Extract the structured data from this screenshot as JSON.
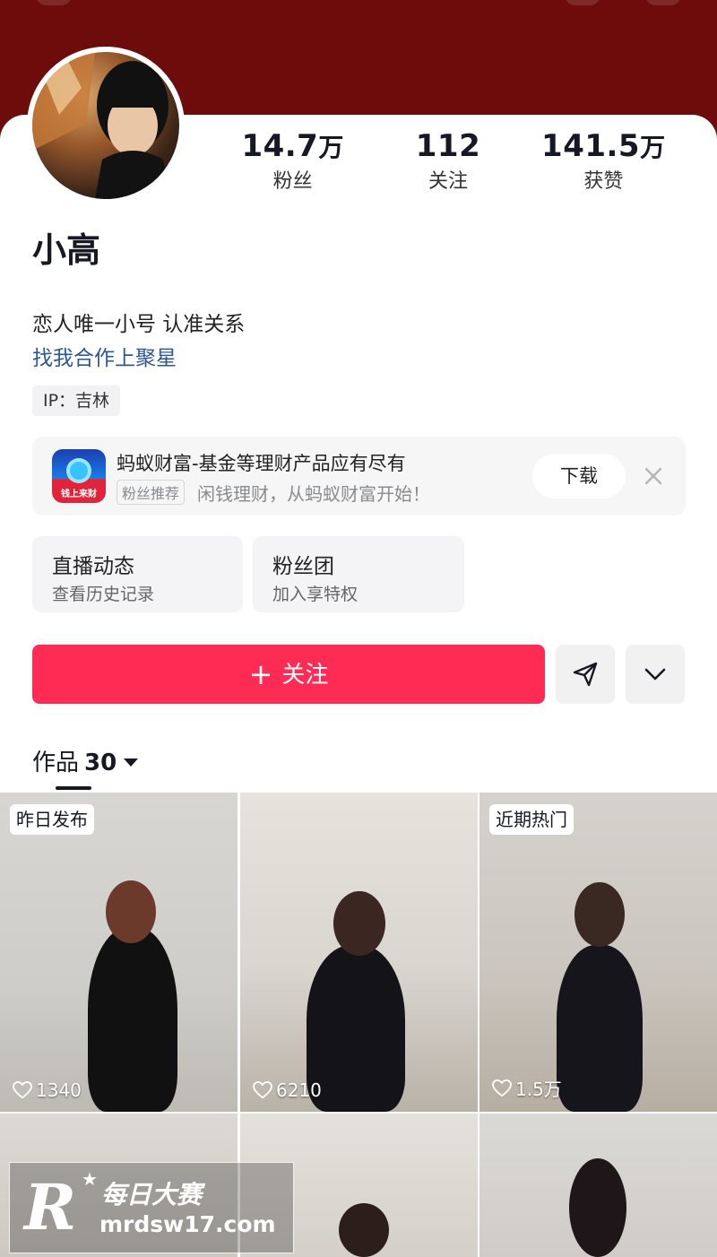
{
  "profile": {
    "name": "小高",
    "bio": "恋人唯一小号 认准关系",
    "bio_link": "找我合作上聚星",
    "ip_label": "IP：吉林"
  },
  "stats": [
    {
      "num": "14.7",
      "unit": "万",
      "label": "粉丝"
    },
    {
      "num": "112",
      "unit": "",
      "label": "关注"
    },
    {
      "num": "141.5",
      "unit": "万",
      "label": "获赞"
    }
  ],
  "ad": {
    "icon_caption": "钱上来财",
    "title": "蚂蚁财富-基金等理财产品应有尽有",
    "badge": "粉丝推荐",
    "subtitle": "闲钱理财，从蚂蚁财富开始！",
    "button": "下载"
  },
  "cards": [
    {
      "title": "直播动态",
      "sub": "查看历史记录"
    },
    {
      "title": "粉丝团",
      "sub": "加入享特权"
    }
  ],
  "actions": {
    "follow_plus": "+",
    "follow_label": "关注"
  },
  "tabs": {
    "works_label": "作品",
    "works_count": "30"
  },
  "videos": [
    {
      "label": "昨日发布",
      "likes": "1340"
    },
    {
      "label": "",
      "likes": "6210"
    },
    {
      "label": "近期热门",
      "likes": "1.5万"
    },
    {
      "label": "",
      "likes": ""
    },
    {
      "label": "",
      "likes": ""
    },
    {
      "label": "",
      "likes": ""
    }
  ],
  "watermark": {
    "logo_letter": "R",
    "star": "★",
    "cn_text": "每日大赛",
    "url": "mrdsw17.com"
  },
  "colors": {
    "cover": "#6e0c0c",
    "accent": "#fe2c55",
    "link": "#2c5796"
  }
}
